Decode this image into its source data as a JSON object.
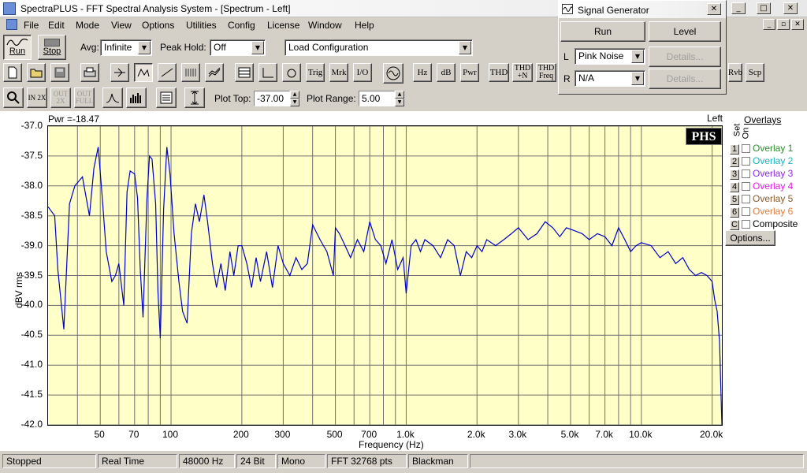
{
  "window": {
    "title": "SpectraPLUS - FFT Spectral Analysis System - [Spectrum - Left]",
    "controls": [
      "_",
      "□",
      "✕"
    ]
  },
  "menu": {
    "items": [
      "File",
      "Edit",
      "Mode",
      "View",
      "Options",
      "Utilities",
      "Config",
      "License",
      "Window",
      "Help"
    ],
    "mdi_controls": [
      "_",
      "▫",
      "✕"
    ]
  },
  "toolbar1": {
    "run_label": "Run",
    "stop_label": "Stop",
    "avg_label": "Avg:",
    "avg_value": "Infinite",
    "peak_hold_label": "Peak Hold:",
    "peak_hold_value": "Off",
    "load_config_value": "Load Configuration"
  },
  "toolbar2": {
    "text_buttons": [
      "Trig",
      "Mrk",
      "I/O",
      "Hz",
      "dB",
      "Pwr",
      "THD",
      "THD +N",
      "THD Freq",
      "Rvb",
      "Scp"
    ]
  },
  "toolbar3": {
    "zoom_in_label": "IN 2X",
    "zoom_out_label": "OUT 2X",
    "zoom_full_label": "OUT FULL",
    "plot_top_label": "Plot Top:",
    "plot_top_value": "-37.00",
    "plot_range_label": "Plot Range:",
    "plot_range_value": "5.00"
  },
  "signal_generator": {
    "title": "Signal Generator",
    "run_label": "Run",
    "level_label": "Level",
    "left_channel_label": "L",
    "left_value": "Pink Noise",
    "right_channel_label": "R",
    "right_value": "N/A",
    "details_label": "Details..."
  },
  "plot": {
    "power_text": "Pwr =-18.47",
    "channel_text": "Left",
    "logo_text": "PHS"
  },
  "overlays": {
    "title": "Overlays",
    "set_label": "Set",
    "on_label": "On",
    "items": [
      {
        "num": "1",
        "label": "Overlay 1",
        "color": "#2e8b2e"
      },
      {
        "num": "2",
        "label": "Overlay 2",
        "color": "#20b0c0"
      },
      {
        "num": "3",
        "label": "Overlay 3",
        "color": "#8a2be2"
      },
      {
        "num": "4",
        "label": "Overlay 4",
        "color": "#e020e0"
      },
      {
        "num": "5",
        "label": "Overlay 5",
        "color": "#8b5a2b"
      },
      {
        "num": "6",
        "label": "Overlay 6",
        "color": "#e08040"
      },
      {
        "num": "C",
        "label": "Composite",
        "color": "#000000"
      }
    ],
    "options_label": "Options..."
  },
  "status": {
    "cells": [
      "Stopped",
      "Real Time",
      "48000 Hz",
      "24 Bit",
      "Mono",
      "FFT 32768 pts",
      "Blackman"
    ]
  },
  "chart_data": {
    "type": "line",
    "xlabel": "Frequency (Hz)",
    "ylabel": "dBV rms",
    "x_scale": "log",
    "xlim": [
      30,
      22000
    ],
    "ylim": [
      -42.0,
      -37.0
    ],
    "y_ticks": [
      "-37.0",
      "-37.5",
      "-38.0",
      "-38.5",
      "-39.0",
      "-39.5",
      "-40.0",
      "-40.5",
      "-41.0",
      "-41.5",
      "-42.0"
    ],
    "x_ticks": [
      {
        "value": 50,
        "label": "50"
      },
      {
        "value": 70,
        "label": "70"
      },
      {
        "value": 100,
        "label": "100"
      },
      {
        "value": 200,
        "label": "200"
      },
      {
        "value": 300,
        "label": "300"
      },
      {
        "value": 500,
        "label": "500"
      },
      {
        "value": 700,
        "label": "700"
      },
      {
        "value": 1000,
        "label": "1.0k"
      },
      {
        "value": 2000,
        "label": "2.0k"
      },
      {
        "value": 3000,
        "label": "3.0k"
      },
      {
        "value": 5000,
        "label": "5.0k"
      },
      {
        "value": 7000,
        "label": "7.0k"
      },
      {
        "value": 10000,
        "label": "10.0k"
      },
      {
        "value": 20000,
        "label": "20.0k"
      }
    ],
    "grid_minor": [
      40,
      60,
      80,
      90,
      400,
      600,
      800,
      900,
      4000,
      6000,
      8000,
      9000
    ],
    "series": [
      {
        "color": "#0000cc",
        "x": [
          30,
          32,
          33,
          35,
          37,
          39,
          42,
          45,
          47,
          49,
          51,
          53,
          56,
          58,
          60,
          63,
          65,
          67,
          70,
          72,
          74,
          76,
          79,
          81,
          83,
          86,
          88,
          90,
          93,
          96,
          99,
          103,
          108,
          112,
          117,
          122,
          127,
          132,
          138,
          143,
          150,
          156,
          163,
          170,
          178,
          185,
          193,
          200,
          210,
          220,
          230,
          240,
          255,
          270,
          285,
          300,
          320,
          340,
          360,
          380,
          400,
          430,
          460,
          490,
          500,
          520,
          550,
          580,
          620,
          660,
          700,
          740,
          780,
          820,
          870,
          920,
          970,
          1000,
          1050,
          1100,
          1150,
          1200,
          1300,
          1400,
          1500,
          1600,
          1700,
          1800,
          1900,
          2000,
          2100,
          2200,
          2400,
          2600,
          2800,
          3000,
          3300,
          3600,
          3900,
          4200,
          4500,
          4800,
          5200,
          5600,
          6000,
          6500,
          7000,
          7500,
          8000,
          8500,
          9000,
          9500,
          10000,
          11000,
          12000,
          13000,
          14000,
          15000,
          16000,
          17000,
          18000,
          19000,
          19500,
          20000,
          20500,
          21000,
          21500,
          22000
        ],
        "y": [
          -38.35,
          -38.5,
          -39.4,
          -40.4,
          -38.3,
          -38.0,
          -37.85,
          -38.5,
          -37.7,
          -37.35,
          -38.2,
          -39.1,
          -39.6,
          -39.5,
          -39.3,
          -40.0,
          -38.1,
          -37.75,
          -37.8,
          -38.2,
          -39.4,
          -40.2,
          -38.2,
          -37.5,
          -37.55,
          -38.3,
          -39.8,
          -40.55,
          -38.4,
          -37.35,
          -37.8,
          -38.8,
          -39.6,
          -40.1,
          -40.3,
          -38.8,
          -38.3,
          -38.6,
          -38.15,
          -38.6,
          -39.3,
          -39.7,
          -39.3,
          -39.75,
          -39.1,
          -39.5,
          -39.0,
          -39.0,
          -39.3,
          -39.7,
          -39.2,
          -39.6,
          -39.1,
          -39.7,
          -39.0,
          -39.3,
          -39.5,
          -39.2,
          -39.4,
          -39.3,
          -38.65,
          -38.9,
          -39.1,
          -39.5,
          -38.7,
          -38.8,
          -39.0,
          -39.2,
          -38.9,
          -39.1,
          -38.6,
          -38.9,
          -39.0,
          -39.3,
          -38.9,
          -39.4,
          -39.2,
          -39.8,
          -39.0,
          -38.9,
          -39.1,
          -38.9,
          -39.0,
          -39.2,
          -38.9,
          -39.0,
          -39.5,
          -39.1,
          -39.2,
          -39.0,
          -39.1,
          -38.9,
          -39.0,
          -38.9,
          -38.8,
          -38.7,
          -38.9,
          -38.8,
          -38.6,
          -38.7,
          -38.85,
          -38.7,
          -38.75,
          -38.8,
          -38.9,
          -38.8,
          -38.85,
          -39.0,
          -38.7,
          -38.9,
          -39.1,
          -39.0,
          -38.95,
          -39.0,
          -39.2,
          -39.1,
          -39.3,
          -39.2,
          -39.4,
          -39.5,
          -39.45,
          -39.5,
          -39.55,
          -39.6,
          -39.9,
          -40.1,
          -40.6,
          -42.0
        ]
      }
    ]
  }
}
